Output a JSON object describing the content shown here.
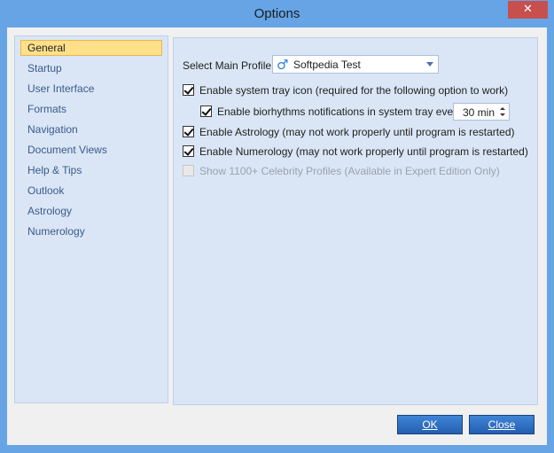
{
  "window": {
    "title": "Options",
    "close_glyph": "✕"
  },
  "nav": {
    "items": [
      {
        "label": "General",
        "selected": true
      },
      {
        "label": "Startup"
      },
      {
        "label": "User Interface"
      },
      {
        "label": "Formats"
      },
      {
        "label": "Navigation"
      },
      {
        "label": "Document Views"
      },
      {
        "label": "Help & Tips"
      },
      {
        "label": "Outlook"
      },
      {
        "label": "Astrology"
      },
      {
        "label": "Numerology"
      }
    ]
  },
  "general": {
    "main_profile_label": "Select Main Profile:",
    "main_profile_value": "Softpedia Test",
    "profile_icon": "male-symbol-icon",
    "options": [
      {
        "label": "Enable system tray icon (required for the following option to work)",
        "checked": true,
        "enabled": true
      },
      {
        "label": "Enable biorhythms notifications in system tray every",
        "checked": true,
        "enabled": true
      },
      {
        "label": "Enable Astrology (may not work properly until program is restarted)",
        "checked": true,
        "enabled": true
      },
      {
        "label": "Enable Numerology (may not work properly until program is restarted)",
        "checked": true,
        "enabled": true
      },
      {
        "label": "Show 1100+ Celebrity Profiles (Available in Expert Edition Only)",
        "checked": false,
        "enabled": false
      }
    ],
    "interval_value": "30 min"
  },
  "buttons": {
    "ok": "OK",
    "close": "Close"
  },
  "colors": {
    "accent": "#2a6ac4",
    "selection": "#ffe08a",
    "panel": "#dae6f5"
  }
}
